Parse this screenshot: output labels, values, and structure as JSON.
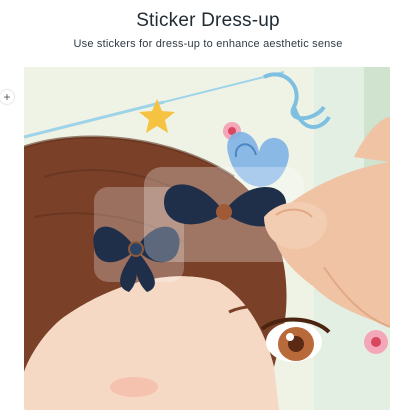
{
  "header": {
    "title": "Sticker Dress-up",
    "subtitle": "Use stickers for dress-up to enhance aesthetic sense"
  },
  "side_control": {
    "icon": "plus-icon",
    "glyph": "+"
  },
  "photo": {
    "alt": "Hand placing a bow sticker on an illustrated girl's hair",
    "colors": {
      "background_card": "#eef3e6",
      "hair": "#7b4128",
      "skin": "#f6d9c4",
      "bow_sticker": "#1f2f4a",
      "butterfly": "#7fb3e6"
    }
  }
}
